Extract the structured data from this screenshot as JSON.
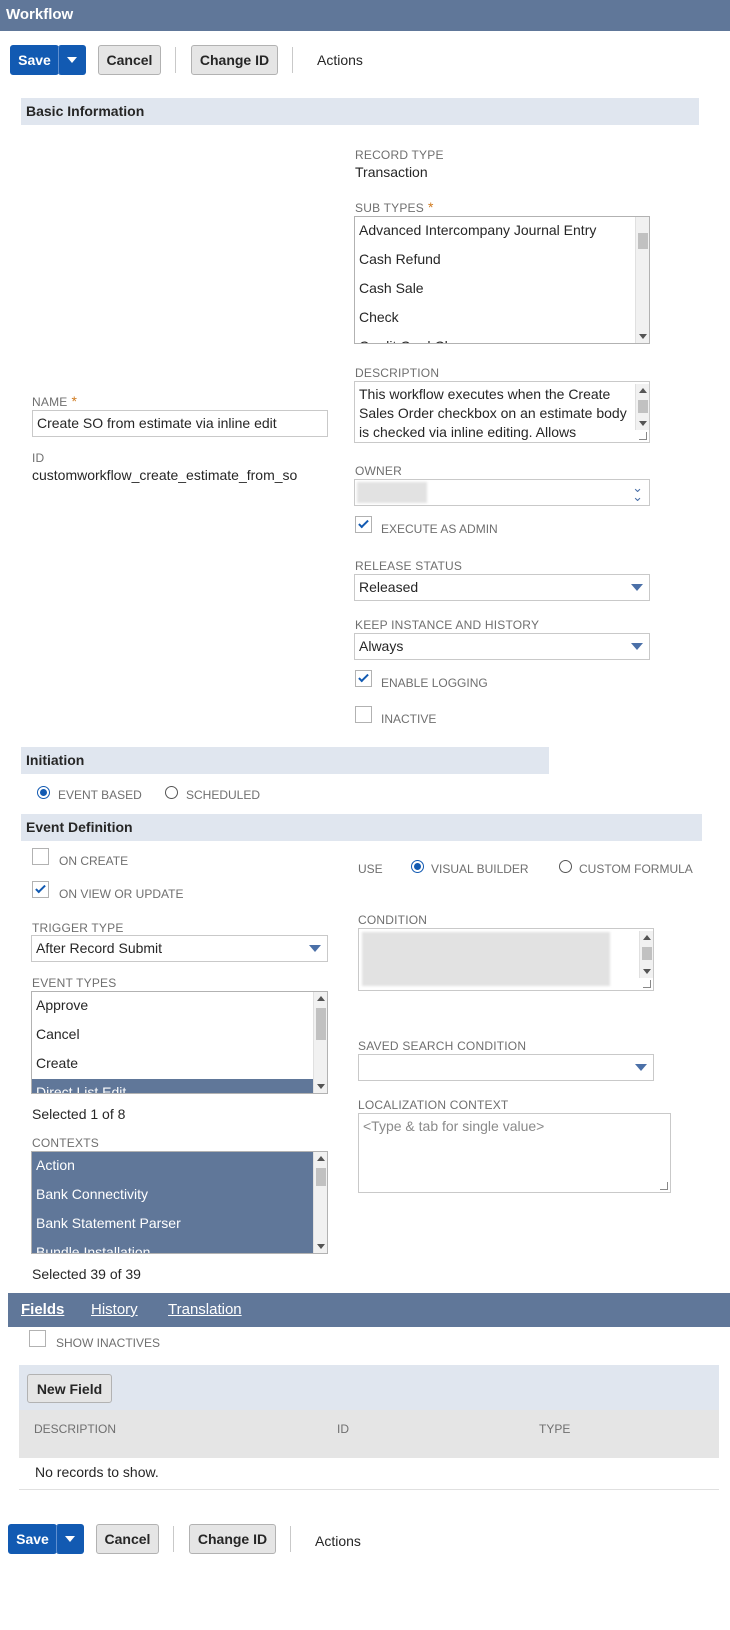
{
  "window": {
    "title": "Workflow"
  },
  "toolbar": {
    "save": "Save",
    "cancel": "Cancel",
    "change_id": "Change ID",
    "actions": "Actions"
  },
  "basic": {
    "section": "Basic Information",
    "record_type_label": "RECORD TYPE",
    "record_type_value": "Transaction",
    "sub_types_label": "SUB TYPES",
    "sub_types": [
      "Advanced Intercompany Journal Entry",
      "Cash Refund",
      "Cash Sale",
      "Check",
      "Credit Card Charge"
    ],
    "name_label": "NAME",
    "name_value": "Create SO from estimate via inline edit",
    "id_label": "ID",
    "id_value": "customworkflow_create_estimate_from_so",
    "description_label": "DESCRIPTION",
    "description_value": "This workflow executes when the Create Sales Order checkbox on an estimate body is checked via inline editing. Allows",
    "owner_label": "OWNER",
    "execute_as_admin": "EXECUTE AS ADMIN",
    "release_status_label": "RELEASE STATUS",
    "release_status_value": "Released",
    "keep_instance_label": "KEEP INSTANCE AND HISTORY",
    "keep_instance_value": "Always",
    "enable_logging": "ENABLE LOGGING",
    "inactive": "INACTIVE"
  },
  "initiation": {
    "section": "Initiation",
    "event_based": "EVENT BASED",
    "scheduled": "SCHEDULED"
  },
  "event": {
    "section": "Event Definition",
    "on_create": "ON CREATE",
    "on_view_update": "ON VIEW OR UPDATE",
    "use_label": "USE",
    "visual_builder": "VISUAL BUILDER",
    "custom_formula": "CUSTOM FORMULA",
    "trigger_type_label": "TRIGGER TYPE",
    "trigger_type_value": "After Record Submit",
    "condition_label": "CONDITION",
    "event_types_label": "EVENT TYPES",
    "event_types": [
      "Approve",
      "Cancel",
      "Create",
      "Direct List Edit"
    ],
    "event_types_selected": "Selected 1 of 8",
    "saved_search_label": "SAVED SEARCH CONDITION",
    "localization_label": "LOCALIZATION CONTEXT",
    "localization_placeholder": "<Type & tab for single value>",
    "contexts_label": "CONTEXTS",
    "contexts": [
      "Action",
      "Bank Connectivity",
      "Bank Statement Parser",
      "Bundle Installation"
    ],
    "contexts_selected": "Selected 39 of 39"
  },
  "subtabs": {
    "tabs": [
      "Fields",
      "History",
      "Translation"
    ],
    "show_inactives": "SHOW INACTIVES",
    "new_field": "New Field",
    "columns": [
      "DESCRIPTION",
      "ID",
      "TYPE"
    ],
    "empty": "No records to show."
  }
}
